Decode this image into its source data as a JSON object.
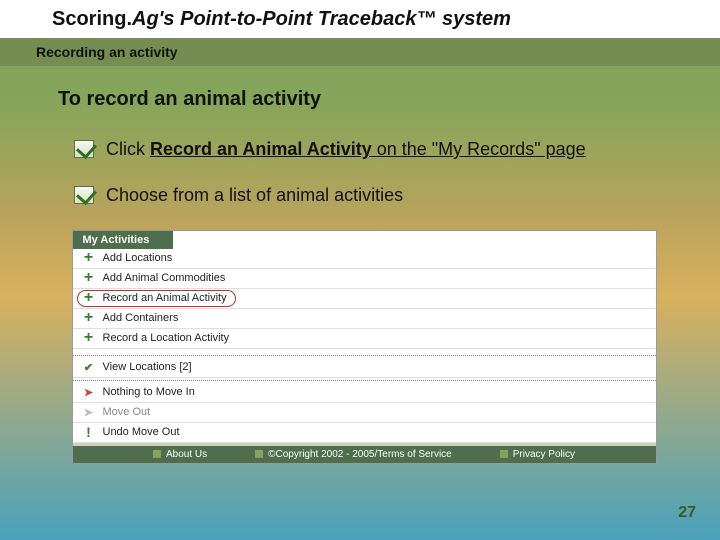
{
  "title": {
    "pre": "Scoring.",
    "main": "Ag's Point-to-Point Traceback™ system"
  },
  "subtitle": "Recording an activity",
  "heading": "To record an animal activity",
  "bullets": [
    {
      "pre": "Click ",
      "bold": "Record an Animal Activity",
      "post": " on the \"My Records\" page"
    },
    {
      "pre": "Choose from a list of animal activities",
      "bold": "",
      "post": ""
    }
  ],
  "panel": {
    "tab": "My Activities",
    "plus_rows": [
      "Add Locations",
      "Add Animal Commodities",
      "Record an Animal Activity",
      "Add Containers",
      "Record a Location Activity"
    ],
    "highlighted_index": 2,
    "check_row": "View Locations [2]",
    "arrow_row": "Nothing to Move In",
    "grey_row": "Move Out",
    "ex_row": "Undo Move Out",
    "footer": [
      "About Us",
      "©Copyright 2002 - 2005/Terms of Service",
      "Privacy Policy"
    ]
  },
  "page_number": "27"
}
